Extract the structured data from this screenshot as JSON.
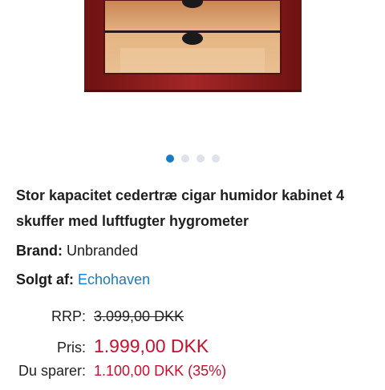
{
  "gallery": {
    "image_alt": "Humidor cabinet with drawers",
    "dot_count": 4,
    "active_index": 0
  },
  "product": {
    "title": "Stor kapacitet cedertræ cigar humidor kabinet 4 skuffer med luftfugter hygrometer",
    "brand_label": "Brand:",
    "brand_value": "Unbranded",
    "seller_label": "Solgt af:",
    "seller_value": "Echohaven"
  },
  "pricing": {
    "rrp_label": "RRP:",
    "rrp_value": "3.099,00 DKK",
    "price_label": "Pris:",
    "price_value": "1.999,00 DKK",
    "savings_label": "Du sparer:",
    "savings_value": "1.100,00 DKK (35%)"
  },
  "colors": {
    "accent": "#1a7bc4",
    "price_red": "#c8102e",
    "wood_frame": "#8f1d1d",
    "cedar": "#d9a070"
  }
}
